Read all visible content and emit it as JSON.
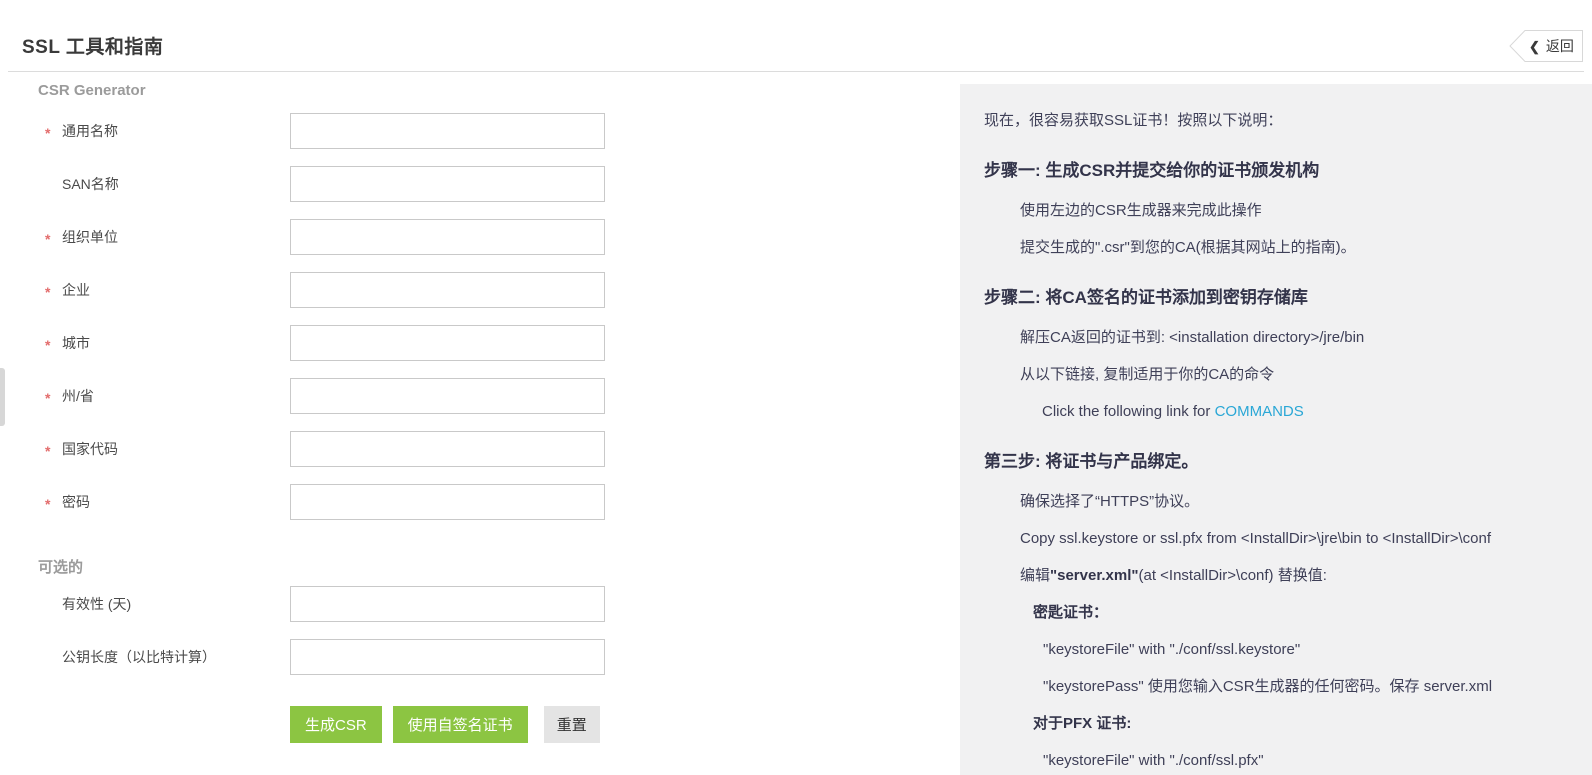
{
  "header": {
    "title": "SSL 工具和指南",
    "back_label": "返回",
    "back_icon": "chevron-left"
  },
  "form": {
    "section_title": "CSR Generator",
    "optional_title": "可选的",
    "required_marker": "*",
    "fields": [
      {
        "label": "通用名称",
        "required": true
      },
      {
        "label": "SAN名称",
        "required": false
      },
      {
        "label": "组织单位",
        "required": true
      },
      {
        "label": "企业",
        "required": true
      },
      {
        "label": "城市",
        "required": true
      },
      {
        "label": "州/省",
        "required": true
      },
      {
        "label": "国家代码",
        "required": true
      },
      {
        "label": "密码",
        "required": true
      }
    ],
    "optional_fields": [
      {
        "label": "有效性 (天)",
        "required": false
      },
      {
        "label": "公钥长度（以比特计算）",
        "required": false
      }
    ],
    "buttons": {
      "generate": "生成CSR",
      "self_signed": "使用自签名证书",
      "reset": "重置"
    }
  },
  "guide": {
    "intro": "现在，很容易获取SSL证书！按照以下说明：",
    "step1": {
      "heading": "步骤一: 生成CSR并提交给你的证书颁发机构",
      "lines": [
        "使用左边的CSR生成器来完成此操作",
        "提交生成的\".csr\"到您的CA(根据其网站上的指南)。"
      ]
    },
    "step2": {
      "heading": "步骤二: 将CA签名的证书添加到密钥存储库",
      "lines": [
        "解压CA返回的证书到: <installation directory>/jre/bin",
        "从以下链接, 复制适用于你的CA的命令"
      ],
      "link_prefix": "Click the following link for ",
      "link_text": "COMMANDS"
    },
    "step3": {
      "heading": "第三步: 将证书与产品绑定。",
      "lines": [
        "确保选择了“HTTPS”协议。",
        "Copy ssl.keystore or ssl.pfx from <InstallDir>\\jre\\bin to <InstallDir>\\conf"
      ],
      "edit_prefix": "编辑",
      "edit_bold": "\"server.xml\"",
      "edit_suffix": "(at <InstallDir>\\conf) 替换值:"
    },
    "keystore": {
      "heading": "密匙证书：",
      "lines": [
        "\"keystoreFile\" with \"./conf/ssl.keystore\"",
        "\"keystorePass\" 使用您输入CSR生成器的任何密码。保存 server.xml"
      ]
    },
    "pfx": {
      "heading": "对于PFX 证书:",
      "lines": [
        "\"keystoreFile\" with \"./conf/ssl.pfx\""
      ]
    }
  },
  "colors": {
    "accent_green": "#8cc542",
    "link_blue": "#2aa7d6",
    "required_red": "#e36c6c",
    "panel_bg": "#f1f1f2"
  }
}
